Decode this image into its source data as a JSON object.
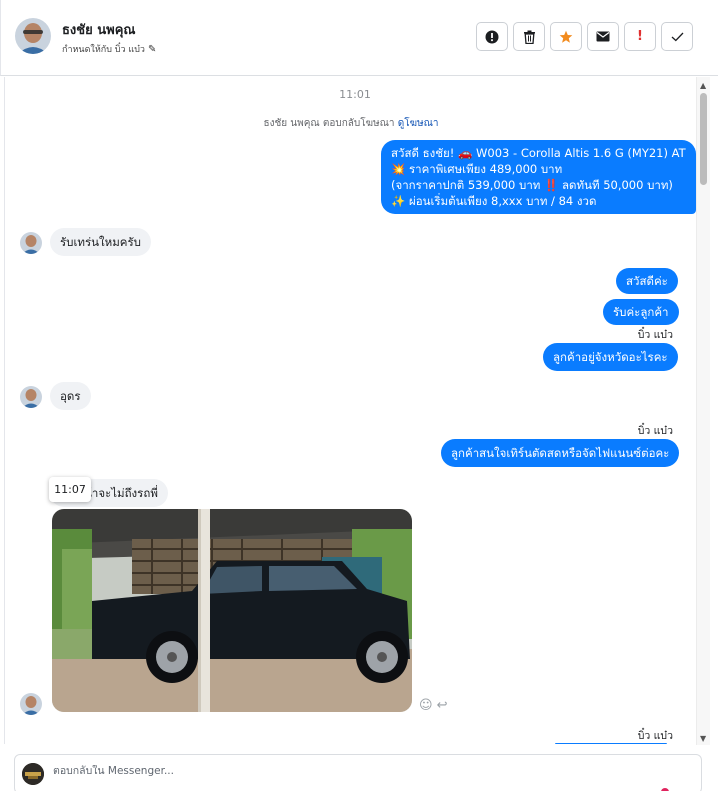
{
  "header": {
    "name": "ธงชัย นพคุณ",
    "subtitle": "กำหนดให้กับ บิ๋ว แบ๋ว",
    "actions": [
      {
        "name": "report-button",
        "icon": "alert-circle-icon",
        "glyph": "❗"
      },
      {
        "name": "delete-button",
        "icon": "trash-icon",
        "glyph": "🗑"
      },
      {
        "name": "star-button",
        "icon": "star-icon",
        "glyph": "★"
      },
      {
        "name": "email-button",
        "icon": "envelope-icon",
        "glyph": "✉"
      },
      {
        "name": "important-button",
        "icon": "exclamation-icon",
        "glyph": "!"
      },
      {
        "name": "done-button",
        "icon": "check-icon",
        "glyph": "✓"
      }
    ]
  },
  "chat": {
    "timestamp": "11:01",
    "ad_reply_prefix": "ธงชัย นพคุณ ตอบกลับโฆษณา",
    "ad_reply_link": "ดูโฆษณา",
    "outgoing_ad": {
      "line1": "สวัสดี ธงชัย! 🚗 W003 - Corolla Altis 1.6 G (MY21) AT",
      "line2": "💥 ราคาพิเศษเพียง 489,000 บาท",
      "line3": "(จากราคาปกติ 539,000 บาท ‼️ ลดทันที 50,000 บาท)",
      "line4": "✨ ผ่อนเริ่มต้นเพียง 8,xxx บาท / 84 งวด"
    },
    "incoming_1": "รับเทร่นใหมครับ",
    "outgoing_1": "สวัสดีค่ะ",
    "outgoing_2": "รับค่ะลูกค้า",
    "seen_1": "บิ๋ว แบ๋ว",
    "outgoing_3": "ลูกค้าอยู่จังหวัดอะไรคะ",
    "incoming_2": "อุดร",
    "seen_2": "บิ๋ว แบ๋ว",
    "outgoing_4": "ลูกค้าสนใจเทิร์นตัดสดหรือจัดไฟแนนซ์ต่อคะ",
    "incoming_3": "น้าจะไม่ถึงรถพี่",
    "tooltip_time": "11:07",
    "seen_3": "บิ๋ว แบ๋ว"
  },
  "composer": {
    "placeholder": "ตอบกลับใน Messenger..."
  },
  "colors": {
    "outgoing_bubble": "#0a7cff",
    "incoming_bubble": "#f0f2f5",
    "link": "#1455b5"
  }
}
